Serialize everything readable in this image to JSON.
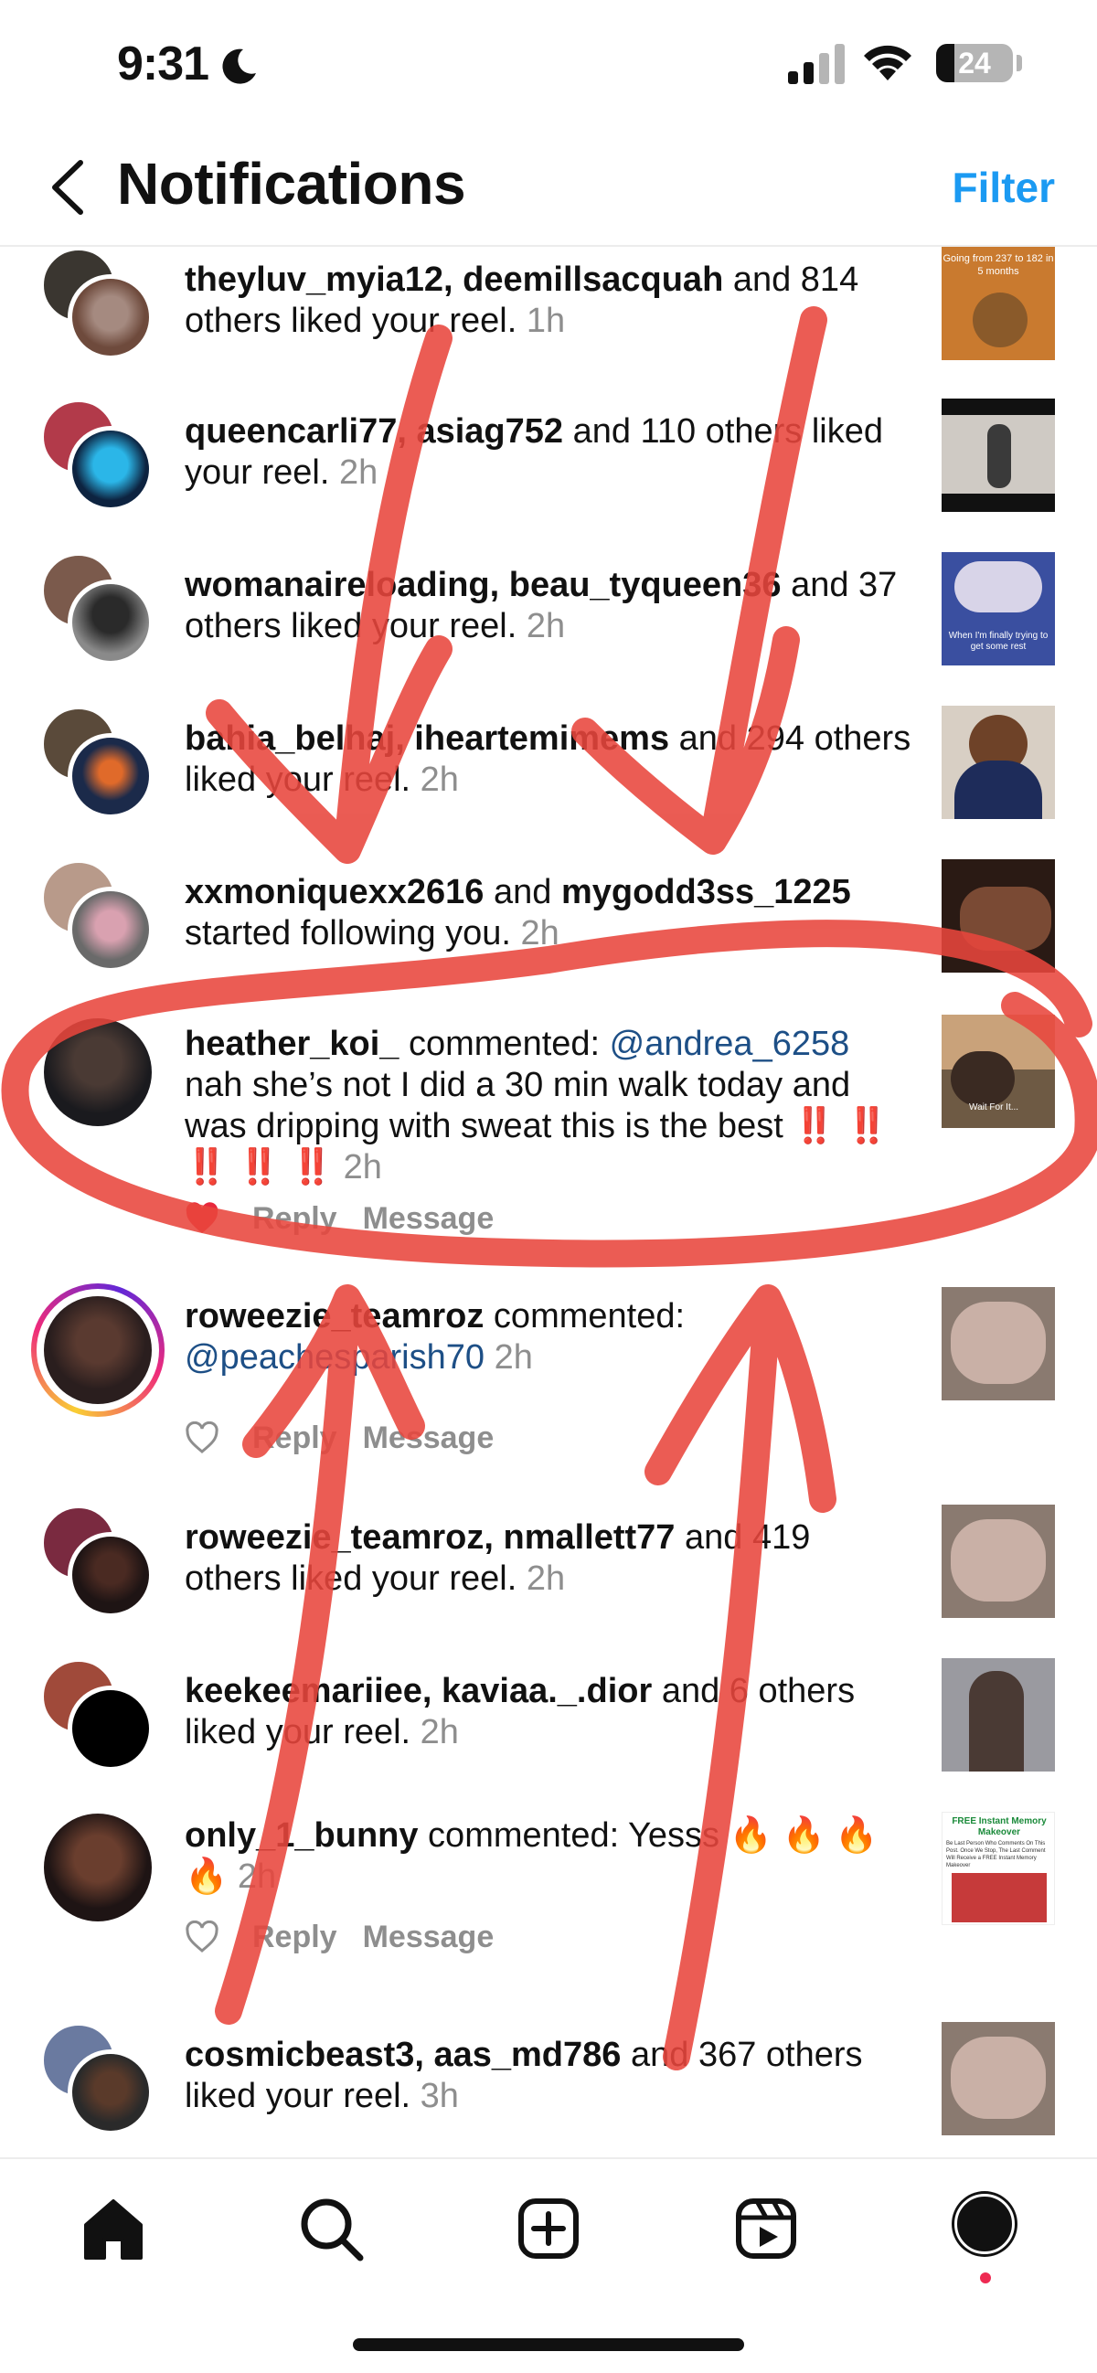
{
  "status": {
    "time": "9:31",
    "battery": "24"
  },
  "header": {
    "title": "Notifications",
    "filter": "Filter"
  },
  "notifications": [
    {
      "users": "theyluv_myia12, deemillsacquah",
      "text": " and 814 others liked your reel. ",
      "time": "1h"
    },
    {
      "users": "queencarli77, asiag752",
      "text": " and 110 others liked your reel. ",
      "time": "2h"
    },
    {
      "users": "womanaireloading, beau_tyqueen36",
      "text": " and 37 others liked your reel. ",
      "time": "2h"
    },
    {
      "users": "bahia_belhaj, iheartemimems",
      "text": " and 294 others liked your reel. ",
      "time": "2h"
    },
    {
      "users": "xxmoniquexx2616",
      "middle": " and ",
      "users2": "mygodd3ss_1225",
      "text": " started following you. ",
      "time": "2h"
    },
    {
      "users": "heather_koi_",
      "text": " commented: ",
      "mention": "@andrea_6258",
      "comment": " nah she’s not I did a 30 min walk today and was dripping with sweat this is the best ",
      "emoji": "‼️ ‼️ ‼️ ‼️ ‼️",
      "time": "2h",
      "reply": "Reply",
      "message": "Message"
    },
    {
      "users": "roweezie_teamroz",
      "text": " commented: ",
      "mention": "@peachesparish70",
      "time": "2h",
      "reply": "Reply",
      "message": "Message"
    },
    {
      "users": "roweezie_teamroz, nmallett77",
      "text": " and 419 others liked your reel. ",
      "time": "2h"
    },
    {
      "users": "keekeemariiee, kaviaa._.dior",
      "text": " and 6 others liked your reel. ",
      "time": "2h"
    },
    {
      "users": "only_1_bunny",
      "text": " commented: Yesss ",
      "emoji": "🔥 🔥 🔥 🔥",
      "time": "2h",
      "reply": "Reply",
      "message": "Message"
    },
    {
      "users": "cosmicbeast3, aas_md786",
      "text": " and 367 others liked your reel. ",
      "time": "3h"
    }
  ],
  "thumbs": {
    "t0": "Going from 237 to 182 in 5 months",
    "t2": "When I'm finally trying to get some rest",
    "t5": "Wait For It...",
    "t9_title": "FREE Instant Memory Makeover",
    "t9_body": "Be Last Person Who Comments On This Post. Once We Stop, The Last Comment Will Receive a FREE Instant Memory Makeover"
  },
  "tabs": [
    "home-icon",
    "search-icon",
    "create-icon",
    "reels-icon",
    "profile-icon"
  ],
  "colors": {
    "accent": "#1b9af2",
    "liked_heart": "#e8283c",
    "annotation": "#e8453c"
  }
}
